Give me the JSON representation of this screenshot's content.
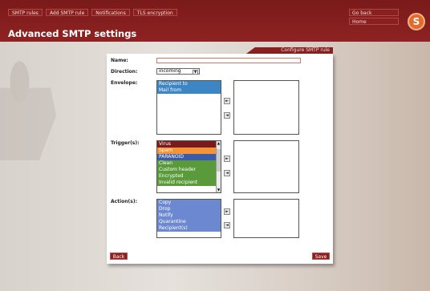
{
  "top_tabs": [
    "SMTP rules",
    "Add SMTP rule",
    "Notifications",
    "TLS encryption"
  ],
  "page_title": "Advanced SMTP settings",
  "right_nav": [
    "Go back",
    "Home"
  ],
  "logo_letter": "S",
  "panel_title": "Configure SMTP rule",
  "form": {
    "name_label": "Name:",
    "name_value": "",
    "direction_label": "Direction:",
    "direction_value": "incoming",
    "envelope_label": "Envelope:",
    "envelope_items": [
      "Recipient to",
      "Mail from"
    ],
    "triggers_label": "Trigger(s):",
    "trigger_items": [
      "Virus",
      "Spam",
      "PARANOID",
      "Clean",
      "Custom header",
      "Encrypted",
      "Invalid recipient"
    ],
    "actions_label": "Action(s):",
    "action_items": [
      "Copy",
      "Drop",
      "Notify",
      "Quarantine",
      "Recipient(s)"
    ],
    "add_arrow": "►",
    "remove_arrow": "◄"
  },
  "buttons": {
    "back": "Back",
    "save": "Save"
  },
  "colors": {
    "brand_red": "#8a1f1f",
    "envelope_blue": "#3d86c5",
    "virus": "#7a1a1a",
    "spam": "#f29437",
    "paranoid": "#3b5ba8",
    "green": "#5a9a3a",
    "action_blue": "#6c88d0"
  }
}
